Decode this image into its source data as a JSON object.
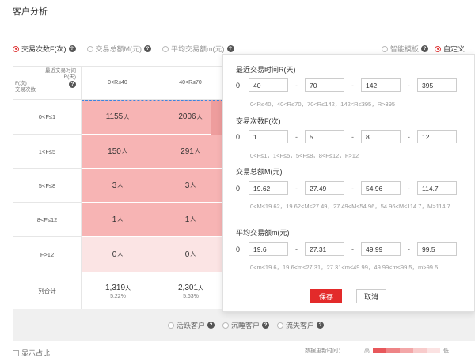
{
  "page_title": "客户分析",
  "metrics": [
    {
      "label": "交易次数F(次)",
      "checked": true
    },
    {
      "label": "交易总额M(元)",
      "checked": false
    },
    {
      "label": "平均交易额m(元)",
      "checked": false
    }
  ],
  "modes": [
    {
      "label": "智能模板",
      "checked": false
    },
    {
      "label": "自定义",
      "checked": true
    }
  ],
  "table": {
    "corner_top": [
      "最近交易时间",
      "R(天)"
    ],
    "corner_bottom": [
      "F(次)",
      "交易次数"
    ],
    "columns": [
      "0<R≤40",
      "40<R≤70"
    ],
    "rows": [
      {
        "label": "0<F≤1",
        "values": [
          "1155",
          "2006"
        ]
      },
      {
        "label": "1<F≤5",
        "values": [
          "150",
          "291"
        ]
      },
      {
        "label": "5<F≤8",
        "values": [
          "3",
          "3"
        ]
      },
      {
        "label": "8<F≤12",
        "values": [
          "1",
          "1"
        ]
      },
      {
        "label": "F>12",
        "values": [
          "0",
          "0"
        ]
      }
    ],
    "unit": "人",
    "total_label": "列合计",
    "totals": [
      {
        "value": "1,319",
        "pct": "5.22%"
      },
      {
        "value": "2,301",
        "pct": "5.63%"
      }
    ]
  },
  "segments": [
    {
      "label": "活跃客户"
    },
    {
      "label": "沉睡客户"
    },
    {
      "label": "流失客户"
    }
  ],
  "footer": {
    "show_pct": "显示占比",
    "legend_label": "数据更新时间：",
    "legend_high": "高",
    "legend_low": "低",
    "legend_colors": [
      "#e8575b",
      "#ee8486",
      "#f3a7a8",
      "#f8cbcb",
      "#fbe2e2"
    ]
  },
  "popup": {
    "sections": [
      {
        "title": "最近交易时间R(天)",
        "values": [
          "40",
          "70",
          "142",
          "395"
        ],
        "hint": "0<R≤40，40<R≤70，70<R≤142，142<R≤395，R>395"
      },
      {
        "title": "交易次数F(次)",
        "values": [
          "1",
          "5",
          "8",
          "12"
        ],
        "hint": "0<F≤1，1<F≤5，5<F≤8，8<F≤12，F>12"
      },
      {
        "title": "交易总额M(元)",
        "values": [
          "19.62",
          "27.49",
          "54.96",
          "114.7"
        ],
        "hint": "0<M≤19.62，19.62<M≤27.49，27.49<M≤54.96，54.96<M≤114.7，M>114.7"
      },
      {
        "title": "平均交易额m(元)",
        "values": [
          "19.6",
          "27.31",
          "49.99",
          "99.5"
        ],
        "hint": "0<m≤19.6，19.6<m≤27.31，27.31<m≤49.99，49.99<m≤99.5，m>99.5"
      }
    ],
    "zero": "0",
    "dash": "-",
    "save": "保存",
    "cancel": "取消"
  }
}
